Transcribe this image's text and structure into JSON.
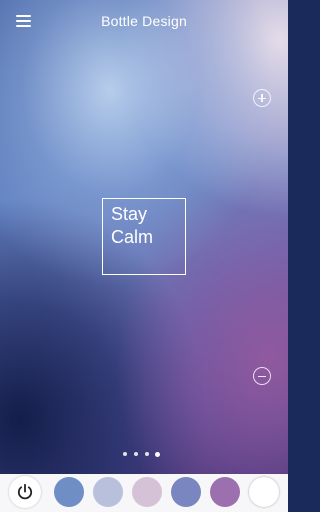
{
  "header": {
    "title": "Bottle Design",
    "menu_icon": "hamburger-menu-icon"
  },
  "zoom": {
    "in_icon": "plus-circle-icon",
    "out_icon": "minus-circle-icon"
  },
  "label": {
    "line1": "Stay",
    "line2": "Calm"
  },
  "pager": {
    "count": 4,
    "active_index": 3
  },
  "bottom_bar": {
    "power_icon": "power-icon",
    "swatches": [
      {
        "color": "#6f8ec6"
      },
      {
        "color": "#b8c0dc"
      },
      {
        "color": "#d6c2d6"
      },
      {
        "color": "#7a86bf"
      },
      {
        "color": "#9c6fae"
      },
      {
        "color": "#ffffff"
      }
    ]
  },
  "colors": {
    "accent_text": "#ffffff",
    "bar_background": "#f7f7f9"
  }
}
